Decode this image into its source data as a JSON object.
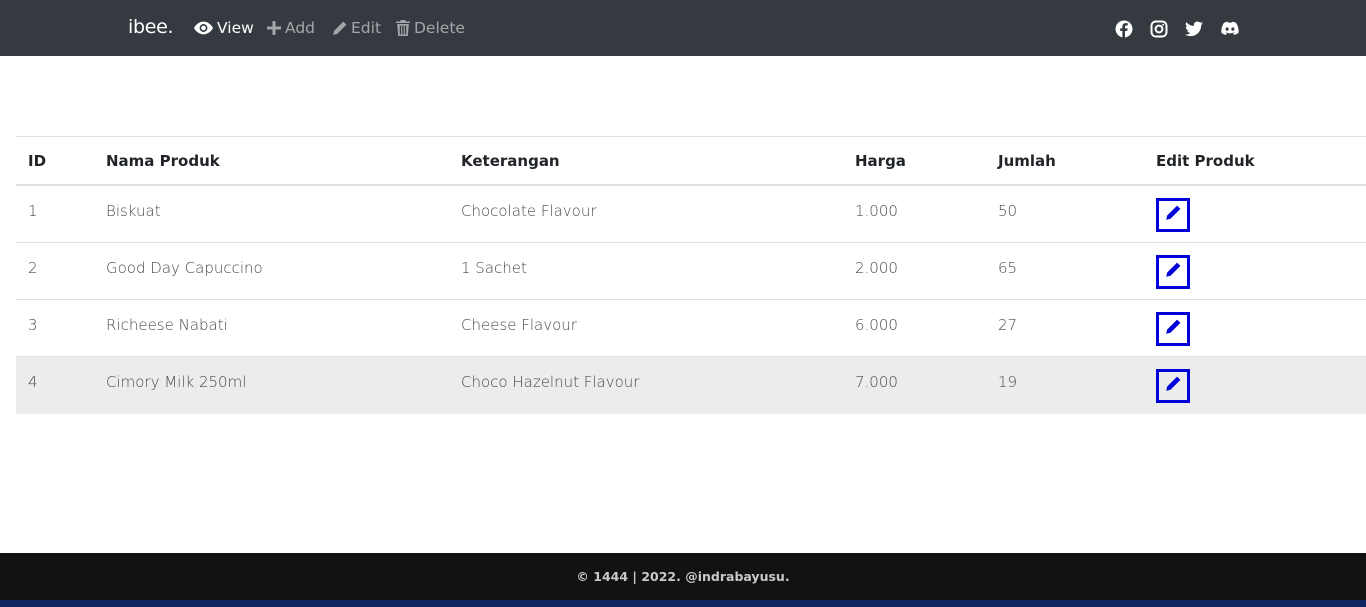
{
  "navbar": {
    "brand": "ibee.",
    "items": [
      {
        "label": "View",
        "icon": "eye-icon",
        "active": true
      },
      {
        "label": "Add",
        "icon": "plus-icon",
        "active": false
      },
      {
        "label": "Edit",
        "icon": "pencil-icon",
        "active": false
      },
      {
        "label": "Delete",
        "icon": "trash-icon",
        "active": false
      }
    ],
    "social": [
      "facebook-icon",
      "instagram-icon",
      "twitter-icon",
      "discord-icon"
    ]
  },
  "table": {
    "headers": [
      "ID",
      "Nama Produk",
      "Keterangan",
      "Harga",
      "Jumlah",
      "Edit Produk"
    ],
    "rows": [
      {
        "id": "1",
        "nama": "Biskuat",
        "keterangan": "Chocolate Flavour",
        "harga": "1.000",
        "jumlah": "50"
      },
      {
        "id": "2",
        "nama": "Good Day Capuccino",
        "keterangan": "1 Sachet",
        "harga": "2.000",
        "jumlah": "65"
      },
      {
        "id": "3",
        "nama": "Richeese Nabati",
        "keterangan": "Cheese Flavour",
        "harga": "6.000",
        "jumlah": "27"
      },
      {
        "id": "4",
        "nama": "Cimory Milk 250ml",
        "keterangan": "Choco Hazelnut Flavour",
        "harga": "7.000",
        "jumlah": "19"
      }
    ]
  },
  "footer": {
    "text": "© 1444 | 2022. @indrabayusu."
  },
  "colors": {
    "navbar": "#343a40",
    "edit_accent": "#0000d8",
    "footer": "#121212",
    "footer_bar": "#0d2461"
  }
}
